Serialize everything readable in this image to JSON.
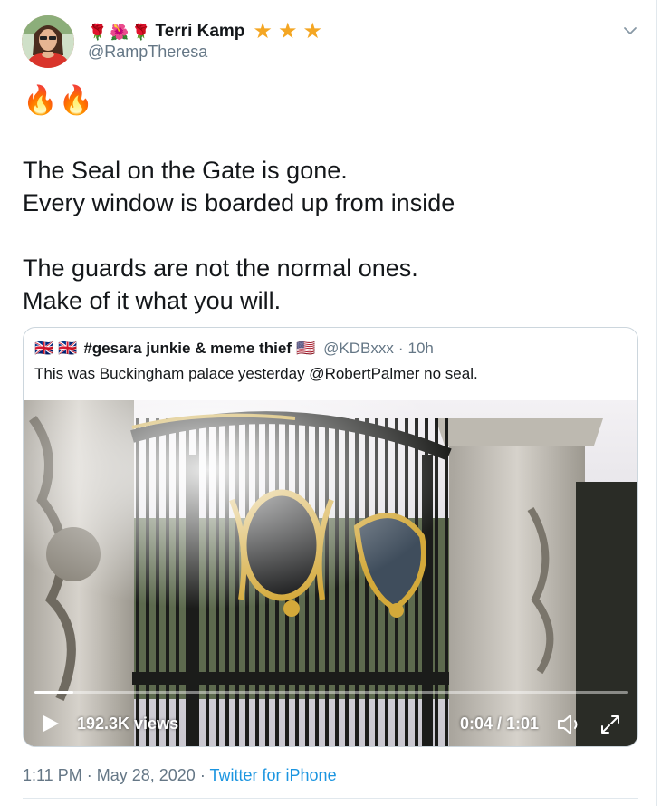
{
  "author": {
    "name_emojis": [
      "🌹",
      "🌺",
      "🌹"
    ],
    "display_name": "Terri Kamp",
    "stars": [
      "★",
      "★",
      "★"
    ],
    "handle": "@RampTheresa",
    "avatar": "profile-photo"
  },
  "tweet": {
    "emojis": "🔥🔥",
    "lines": [
      "The Seal on the Gate is gone.",
      "Every window is boarded up from inside",
      "",
      "The guards are not the normal ones.",
      "Make of it what you will."
    ]
  },
  "quoted": {
    "flags": [
      "🇬🇧",
      "🇬🇧"
    ],
    "display_name": "#gesara junkie & meme thief",
    "name_flag": "🇺🇸",
    "handle": "@KDBxxx",
    "separator": "·",
    "time": "10h",
    "text": "This was Buckingham palace yesterday @RobertPalmer no seal.",
    "video": {
      "views": "192.3K views",
      "timecode": "0:04 / 1:01",
      "progress": 0.065,
      "icons": [
        "play-icon",
        "volume-icon",
        "fullscreen-icon"
      ]
    }
  },
  "footer": {
    "time": "1:11 PM",
    "dot1": "·",
    "date": "May 28, 2020",
    "dot2": "·",
    "source": "Twitter for iPhone"
  },
  "colors": {
    "link": "#1b95e0",
    "muted": "#657786",
    "text": "#14171a",
    "star": "#f4a623",
    "border": "#ccd6dd"
  }
}
